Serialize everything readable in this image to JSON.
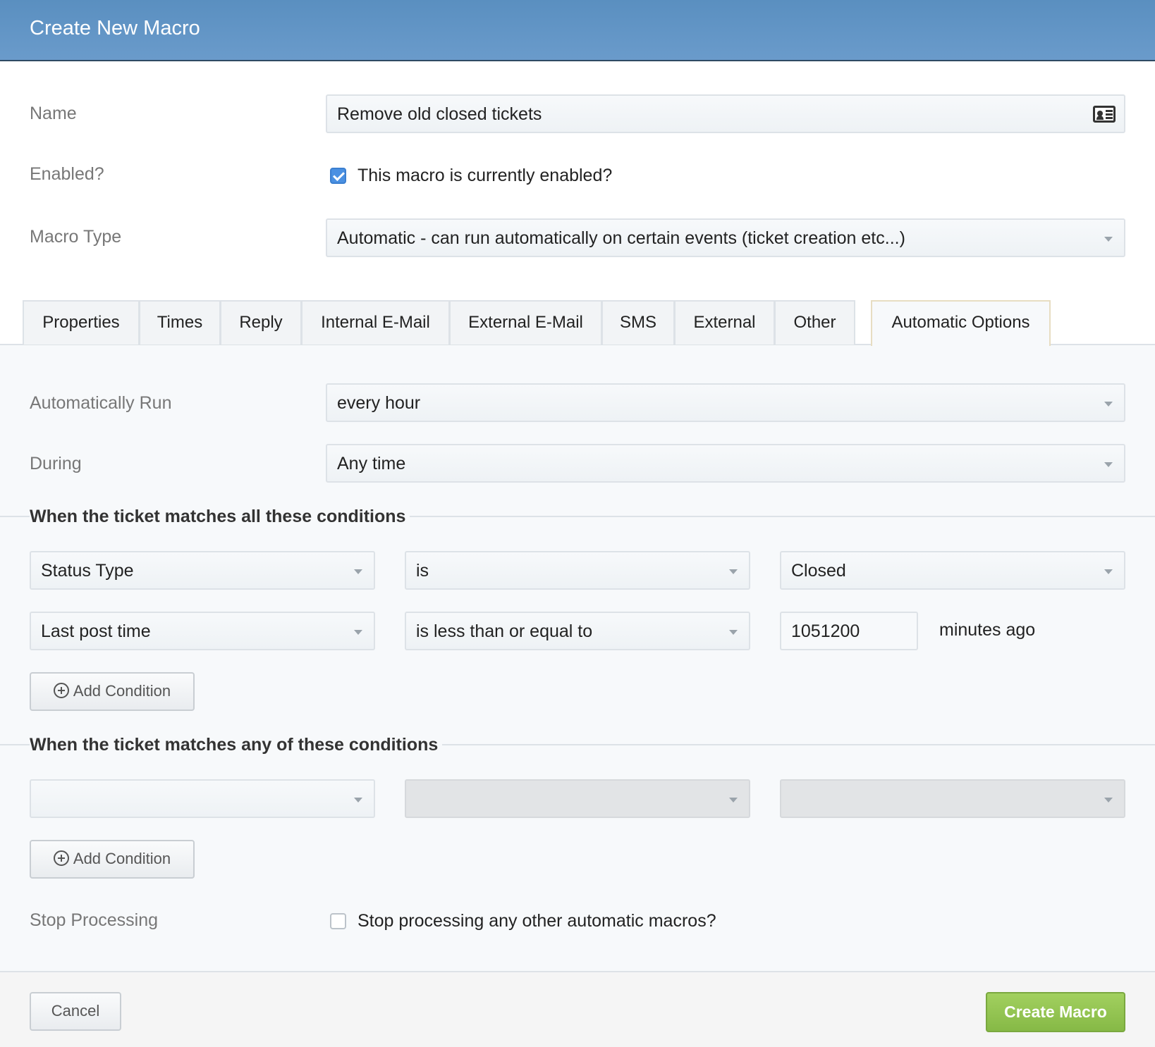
{
  "header": {
    "title": "Create New Macro"
  },
  "form": {
    "name_label": "Name",
    "name_value": "Remove old closed tickets",
    "enabled_label": "Enabled?",
    "enabled_text": "This macro is currently enabled?",
    "enabled_checked": true,
    "type_label": "Macro Type",
    "type_value": "Automatic - can run automatically on certain events (ticket creation etc...)"
  },
  "tabs": [
    {
      "label": "Properties",
      "active": false
    },
    {
      "label": "Times",
      "active": false
    },
    {
      "label": "Reply",
      "active": false
    },
    {
      "label": "Internal E-Mail",
      "active": false
    },
    {
      "label": "External E-Mail",
      "active": false
    },
    {
      "label": "SMS",
      "active": false
    },
    {
      "label": "External",
      "active": false
    },
    {
      "label": "Other",
      "active": false
    },
    {
      "label": "Automatic Options",
      "active": true
    }
  ],
  "automatic": {
    "run_label": "Automatically Run",
    "run_value": "every hour",
    "during_label": "During",
    "during_value": "Any time"
  },
  "all_conditions": {
    "title": "When the ticket matches all these conditions",
    "rows": [
      {
        "field": "Status Type",
        "operator": "is",
        "value": "Closed"
      },
      {
        "field": "Last post time",
        "operator": "is less than or equal to",
        "value": "1051200",
        "suffix": "minutes ago"
      }
    ],
    "add_label": "Add Condition"
  },
  "any_conditions": {
    "title": "When the ticket matches any of these conditions",
    "rows": [
      {
        "field": "",
        "operator": "",
        "value": ""
      }
    ],
    "add_label": "Add Condition"
  },
  "stop": {
    "label": "Stop Processing",
    "text": "Stop processing any other automatic macros?",
    "checked": false
  },
  "footer": {
    "cancel_label": "Cancel",
    "create_label": "Create Macro"
  }
}
